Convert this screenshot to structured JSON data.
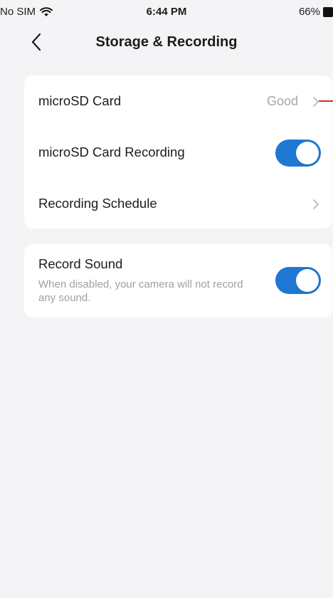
{
  "status_bar": {
    "carrier": "No SIM",
    "time": "6:44 PM",
    "battery": "66%"
  },
  "header": {
    "title": "Storage & Recording"
  },
  "storage_card": {
    "microsd": {
      "label": "microSD Card",
      "value": "Good"
    },
    "recording": {
      "label": "microSD Card Recording",
      "enabled": true
    },
    "schedule": {
      "label": "Recording Schedule"
    }
  },
  "sound_card": {
    "label": "Record Sound",
    "description": "When disabled, your camera will not record any sound.",
    "enabled": true
  },
  "colors": {
    "accent": "#1f77d4",
    "background": "#f4f4f6",
    "card": "#ffffff",
    "secondary_text": "#a0a0a5"
  }
}
